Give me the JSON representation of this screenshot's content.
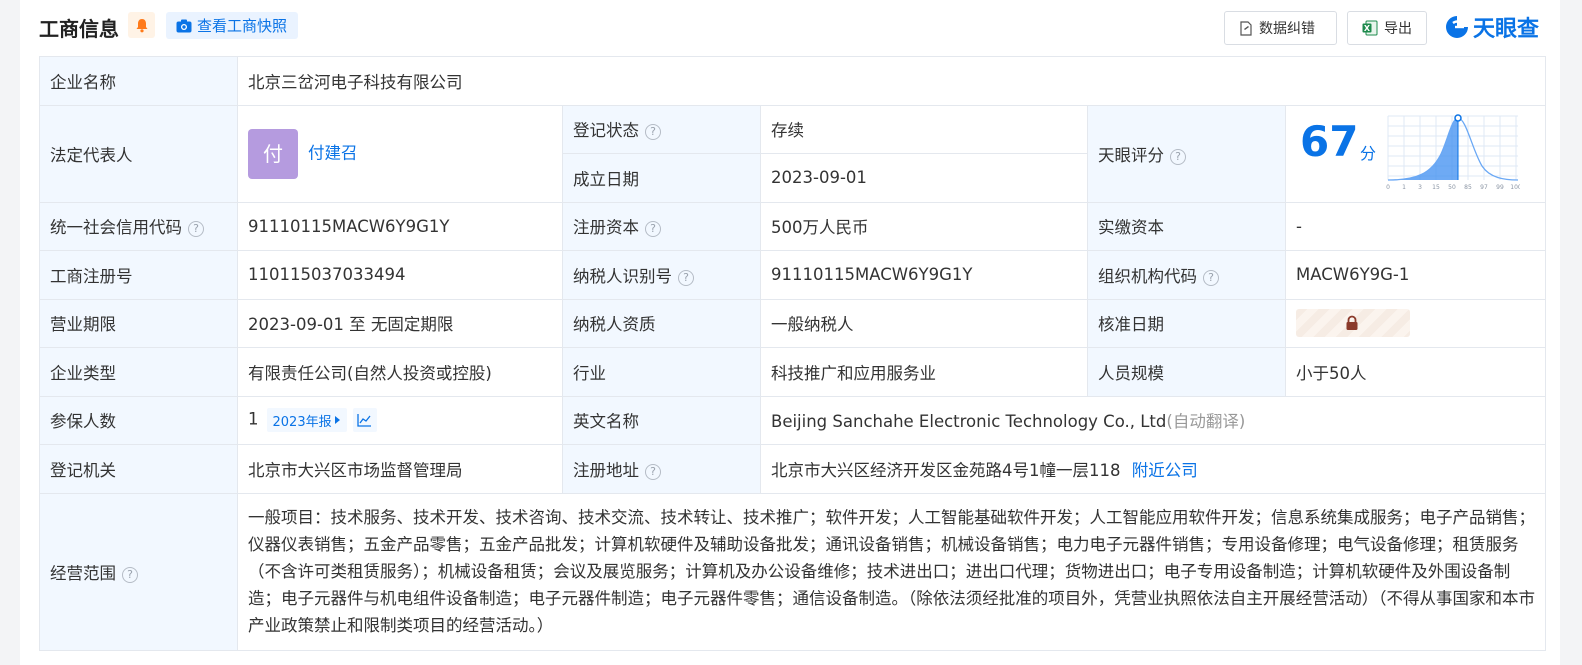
{
  "header": {
    "title": "工商信息",
    "snapshot_label": "查看工商快照",
    "correct_label": "数据纠错",
    "export_label": "导出",
    "brand": "天眼查"
  },
  "rows": {
    "company_name": {
      "label": "企业名称",
      "value": "北京三岔河电子科技有限公司"
    },
    "legal_rep": {
      "label": "法定代表人",
      "avatar": "付",
      "name": "付建召"
    },
    "reg_status": {
      "label": "登记状态",
      "value": "存续"
    },
    "found_date": {
      "label": "成立日期",
      "value": "2023-09-01"
    },
    "score": {
      "label": "天眼评分",
      "value": "67",
      "unit": "分",
      "axis": [
        "0",
        "1",
        "3",
        "15",
        "50",
        "85",
        "97",
        "99",
        "100"
      ]
    },
    "credit_code": {
      "label": "统一社会信用代码",
      "value": "91110115MACW6Y9G1Y"
    },
    "reg_capital": {
      "label": "注册资本",
      "value": "500万人民币"
    },
    "paid_capital": {
      "label": "实缴资本",
      "value": "-"
    },
    "biz_reg_no": {
      "label": "工商注册号",
      "value": "110115037033494"
    },
    "taxpayer_id": {
      "label": "纳税人识别号",
      "value": "91110115MACW6Y9G1Y"
    },
    "org_code": {
      "label": "组织机构代码",
      "value": "MACW6Y9G-1"
    },
    "term": {
      "label": "营业期限",
      "value": "2023-09-01 至 无固定期限"
    },
    "taxpayer_qual": {
      "label": "纳税人资质",
      "value": "一般纳税人"
    },
    "approve_date": {
      "label": "核准日期"
    },
    "company_type": {
      "label": "企业类型",
      "value": "有限责任公司(自然人投资或控股)"
    },
    "industry": {
      "label": "行业",
      "value": "科技推广和应用服务业"
    },
    "staff_size": {
      "label": "人员规模",
      "value": "小于50人"
    },
    "insured": {
      "label": "参保人数",
      "value": "1",
      "year_tag": "2023年报"
    },
    "english_name": {
      "label": "英文名称",
      "value": "Beijing Sanchahe Electronic Technology Co., Ltd",
      "note": "(自动翻译)"
    },
    "reg_authority": {
      "label": "登记机关",
      "value": "北京市大兴区市场监督管理局"
    },
    "reg_address": {
      "label": "注册地址",
      "value": "北京市大兴区经济开发区金苑路4号1幢一层118",
      "nearby": "附近公司"
    },
    "scope": {
      "label": "经营范围",
      "value": "一般项目：技术服务、技术开发、技术咨询、技术交流、技术转让、技术推广；软件开发；人工智能基础软件开发；人工智能应用软件开发；信息系统集成服务；电子产品销售；仪器仪表销售；五金产品零售；五金产品批发；计算机软硬件及辅助设备批发；通讯设备销售；机械设备销售；电力电子元器件销售；专用设备修理；电气设备修理；租赁服务（不含许可类租赁服务）；机械设备租赁；会议及展览服务；计算机及办公设备维修；技术进出口；进出口代理；货物进出口；电子专用设备制造；计算机软硬件及外围设备制造；电子元器件与机电组件设备制造；电子元器件制造；电子元器件零售；通信设备制造。（除依法须经批准的项目外，凭营业执照依法自主开展经营活动）（不得从事国家和本市产业政策禁止和限制类项目的经营活动。）"
    }
  },
  "colors": {
    "accent": "#0a73e6",
    "label_bg": "#f2f8ff",
    "status_green": "#11a050",
    "avatar": "#b59bdf"
  }
}
